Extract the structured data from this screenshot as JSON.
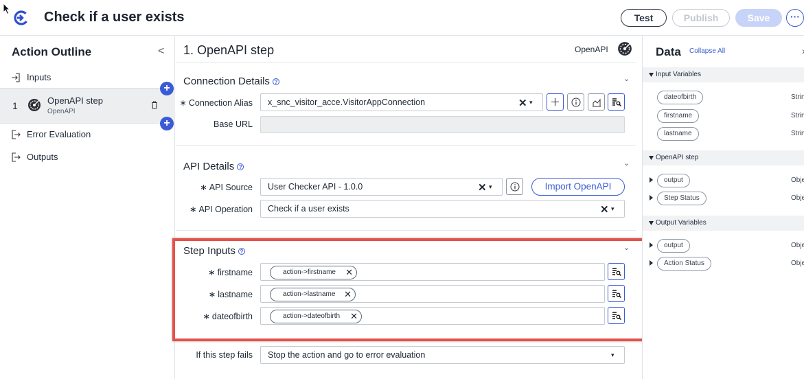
{
  "header": {
    "title": "Check if a user exists",
    "test_label": "Test",
    "publish_label": "Publish",
    "save_label": "Save",
    "more_label": "···"
  },
  "outline": {
    "title": "Action Outline",
    "collapse": "<",
    "inputs": "Inputs",
    "step": {
      "number": "1",
      "name": "OpenAPI step",
      "type": "OpenAPI"
    },
    "error_evaluation": "Error Evaluation",
    "outputs": "Outputs",
    "add_symbol": "+"
  },
  "main": {
    "step_title": "1.  OpenAPI step",
    "step_type": "OpenAPI",
    "help_symbol": "?",
    "connection": {
      "title": "Connection Details",
      "alias_label": "Connection Alias",
      "alias_value": "x_snc_visitor_acce.VisitorAppConnection",
      "base_url_label": "Base URL",
      "base_url_value": ""
    },
    "api": {
      "title": "API Details",
      "source_label": "API Source",
      "source_value": "User Checker API - 1.0.0",
      "operation_label": "API Operation",
      "operation_value": "Check if a user exists",
      "import_label": "Import OpenAPI"
    },
    "step_inputs": {
      "title": "Step Inputs",
      "rows": [
        {
          "label": "firstname",
          "pill": "action->firstname"
        },
        {
          "label": "lastname",
          "pill": "action->lastname"
        },
        {
          "label": "dateofbirth",
          "pill": "action->dateofbirth"
        }
      ]
    },
    "failure": {
      "label": "If this step fails",
      "value": "Stop the action and go to error evaluation"
    },
    "required_mark": "∗",
    "clear_symbol": "✕",
    "dropdown_symbol": "▾",
    "collapse_symbol": "⌄"
  },
  "data_panel": {
    "title": "Data",
    "collapse_all": "Collapse All",
    "close": "›",
    "groups": [
      {
        "label": "Input Variables",
        "items": [
          {
            "name": "dateofbirth",
            "type": "Strin"
          },
          {
            "name": "firstname",
            "type": "Strin"
          },
          {
            "name": "lastname",
            "type": "Strin"
          }
        ]
      },
      {
        "label": "OpenAPI step",
        "items": [
          {
            "name": "output",
            "type": "Obje"
          },
          {
            "name": "Step Status",
            "type": "Obje"
          }
        ]
      },
      {
        "label": "Output Variables",
        "items": [
          {
            "name": "output",
            "type": "Obje"
          },
          {
            "name": "Action Status",
            "type": "Obje"
          }
        ]
      }
    ]
  },
  "colors": {
    "accent": "#3b5bd6",
    "highlight": "#e3524b"
  },
  "icons": [
    "pointer-cursor-icon",
    "back-logo-icon",
    "openapi-step-icon",
    "trash-icon",
    "input-arrow-icon",
    "output-arrow-icon",
    "help-icon",
    "info-icon",
    "plus-icon",
    "pill-picker-icon",
    "chart-icon"
  ]
}
